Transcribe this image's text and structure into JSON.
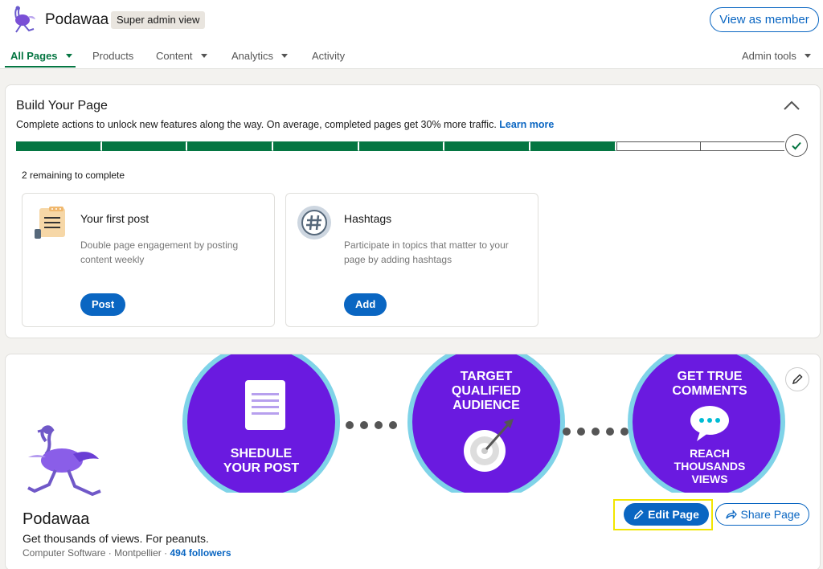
{
  "header": {
    "brand": "Podawaa",
    "badge": "Super admin view",
    "view_as_member": "View as member",
    "logo_icon": "ostrich-logo-icon"
  },
  "nav": {
    "items": [
      {
        "label": "All Pages",
        "dropdown": true,
        "active": true
      },
      {
        "label": "Products",
        "dropdown": false
      },
      {
        "label": "Content",
        "dropdown": true
      },
      {
        "label": "Analytics",
        "dropdown": true
      },
      {
        "label": "Activity",
        "dropdown": false
      }
    ],
    "admin_tools": "Admin tools"
  },
  "build": {
    "title": "Build Your Page",
    "subtitle": "Complete actions to unlock new features along the way. On average, completed pages get 30% more traffic.",
    "learn_more": "Learn more",
    "progress": {
      "completed": 7,
      "total": 9
    },
    "remaining": "2 remaining to complete",
    "tasks": [
      {
        "title": "Your first post",
        "description": "Double page engagement by posting content weekly",
        "button": "Post",
        "icon": "notepad-icon"
      },
      {
        "title": "Hashtags",
        "description": "Participate in topics that matter to your page by adding hashtags",
        "button": "Add",
        "icon": "hashtag-icon"
      }
    ]
  },
  "profile": {
    "banner": {
      "circle1": [
        "SHEDULE",
        "YOUR POST"
      ],
      "circle2": [
        "TARGET",
        "QUALIFIED",
        "AUDIENCE"
      ],
      "circle3_top": [
        "GET TRUE",
        "COMMENTS"
      ],
      "circle3_bottom": [
        "REACH",
        "THOUSANDS",
        "VIEWS"
      ]
    },
    "name": "Podawaa",
    "tagline": "Get thousands of views. For peanuts.",
    "industry": "Computer Software",
    "location": "Montpellier",
    "followers": "494 followers",
    "edit_page": "Edit Page",
    "share_page": "Share Page"
  },
  "colors": {
    "primary": "#0a66c2",
    "success": "#057642",
    "banner_purple": "#6a1ae0",
    "highlight": "#f2e600"
  }
}
